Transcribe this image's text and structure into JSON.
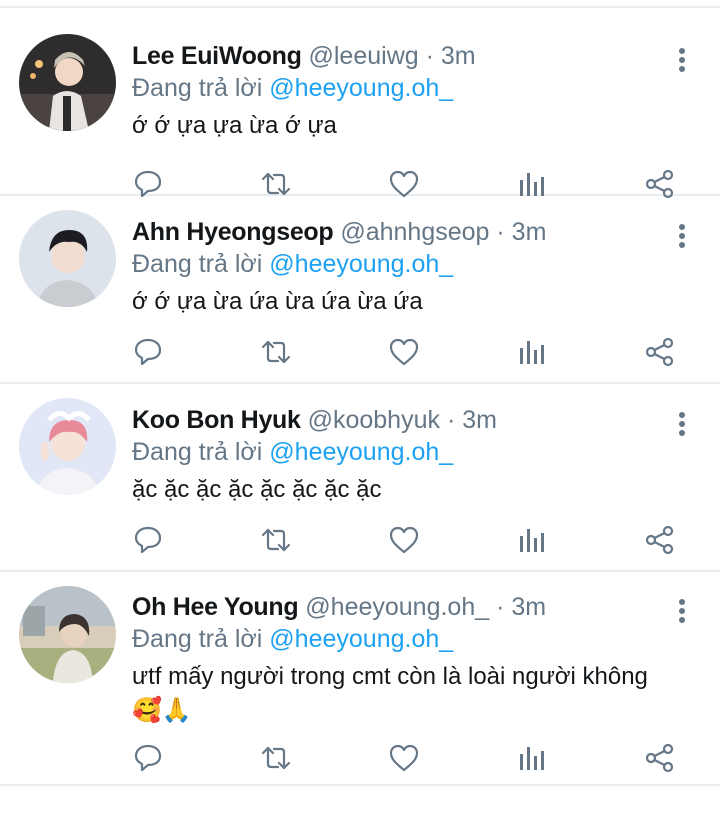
{
  "tweets": [
    {
      "name": "Lee EuiWoong",
      "handle": "@leeuiwg",
      "dot": "·",
      "time": "3m",
      "reply_prefix": "Đang trả lời",
      "reply_to": "@heeyoung.oh_",
      "text": "ớ ớ ựa ựa ừa ớ ựa",
      "avatar_icon": "avatar-photo",
      "avatar_colors": [
        "#3c3a3a",
        "#d7d2cf"
      ]
    },
    {
      "name": "Ahn Hyeongseop",
      "handle": "@ahnhgseop",
      "dot": "·",
      "time": "3m",
      "reply_prefix": "Đang trả lời",
      "reply_to": "@heeyoung.oh_",
      "text": "ớ ớ ựa ừa ứa ừa ứa ừa ứa",
      "avatar_icon": "avatar-photo",
      "avatar_colors": [
        "#d9dfe6",
        "#1f1f24"
      ]
    },
    {
      "name": "Koo Bon Hyuk",
      "handle": "@koobhyuk",
      "dot": "·",
      "time": "3m",
      "reply_prefix": "Đang trả lời",
      "reply_to": "@heeyoung.oh_",
      "text": "ặc ặc ặc ặc ặc ặc ặc ặc",
      "avatar_icon": "avatar-photo",
      "avatar_colors": [
        "#dfe4f6",
        "#e88a9a"
      ]
    },
    {
      "name": "Oh Hee Young",
      "handle": "@heeyoung.oh_",
      "dot": "·",
      "time": "3m",
      "reply_prefix": "Đang trả lời",
      "reply_to": "@heeyoung.oh_",
      "text": "ưtf mấy người trong cmt còn là loài người không",
      "emoji": "🥰🙏",
      "avatar_icon": "avatar-photo",
      "avatar_colors": [
        "#c9b89e",
        "#3a3330"
      ]
    }
  ],
  "action_icons": [
    "reply-icon",
    "retweet-icon",
    "like-icon",
    "analytics-icon",
    "share-icon"
  ],
  "colors": {
    "text": "#14171a",
    "secondary": "#657786",
    "mention": "#1da1f2",
    "separator": "#e6ecf0"
  }
}
